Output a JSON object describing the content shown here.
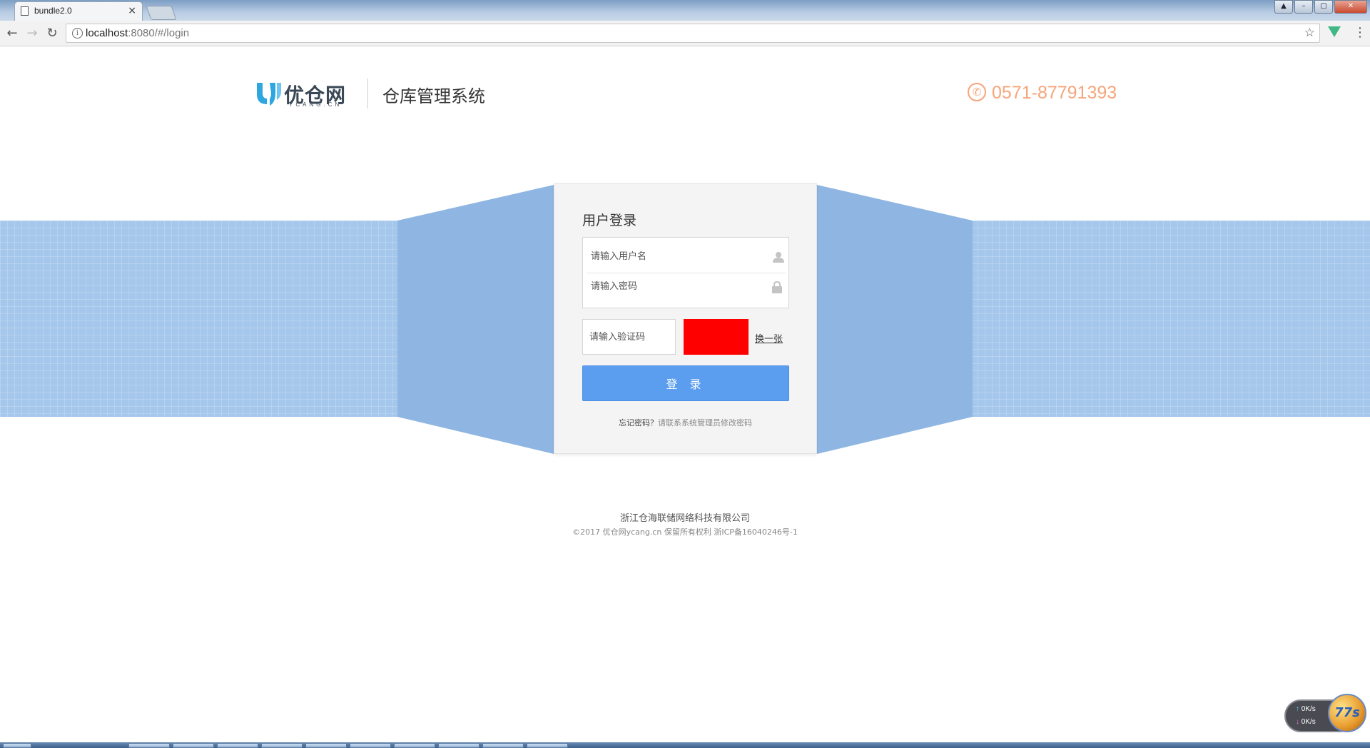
{
  "browser": {
    "tab_title": "bundle2.0",
    "tab_close": "×",
    "url_host": "localhost",
    "url_rest": ":8080/#/login",
    "back": "←",
    "forward": "→",
    "reload": "↻",
    "star": "☆",
    "menu": "⋮",
    "window_buttons": [
      "▲",
      "–",
      "▢",
      "✕"
    ]
  },
  "header": {
    "logo_text": "优仓网",
    "logo_sub": "YCANG.CN",
    "system_title": "仓库管理系统",
    "phone": "0571-87791393"
  },
  "login": {
    "title": "用户登录",
    "username_placeholder": "请输入用户名",
    "password_placeholder": "请输入密码",
    "captcha_placeholder": "请输入验证码",
    "refresh_captcha": "换一张",
    "submit": "登 录",
    "forgot_label": "忘记密码？",
    "forgot_hint": "请联系系统管理员修改密码"
  },
  "footer": {
    "company": "浙江仓海联储网络科技有限公司",
    "copyright": "©2017 优仓网ycang.cn 保留所有权利 浙ICP备16040246号-1"
  },
  "speed_widget": {
    "upload": "0K/s",
    "download": "0K/s",
    "badge": "77s"
  },
  "colors": {
    "accent": "#5b9ef0",
    "banner": "#a5c7ec",
    "phone": "#f7a47a",
    "captcha": "#ff0000"
  }
}
